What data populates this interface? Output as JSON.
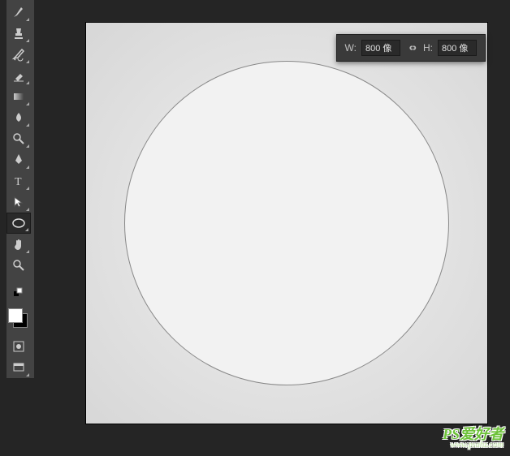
{
  "transform": {
    "w_label": "W:",
    "h_label": "H:",
    "width_value": "800 像",
    "height_value": "800 像"
  },
  "tools": {
    "brush": "brush",
    "stamp": "stamp",
    "history_brush": "history-brush",
    "eraser": "eraser",
    "gradient": "gradient",
    "blur": "blur",
    "dodge": "dodge",
    "pen": "pen",
    "type": "type",
    "path": "path",
    "ellipse": "ellipse",
    "hand": "hand",
    "zoom": "zoom",
    "quickmask": "quick-mask",
    "screenmode": "screen-mode"
  },
  "watermark": {
    "text": "PS爱好者",
    "url": "www.psahz.com"
  }
}
